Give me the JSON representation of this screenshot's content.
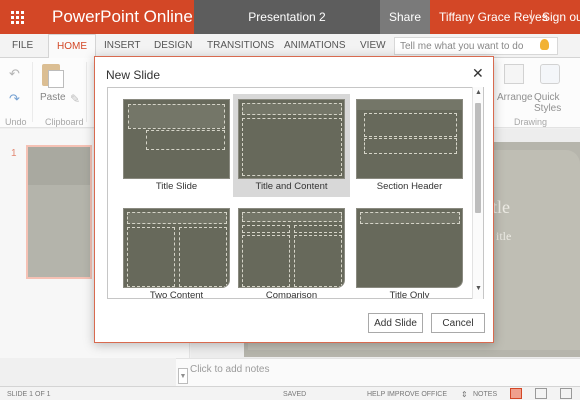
{
  "app": {
    "name": "PowerPoint Online",
    "doc_title": "Presentation 2",
    "share": "Share",
    "user": "Tiffany Grace Reyes",
    "sign_out": "Sign out"
  },
  "ribbon": {
    "tabs": [
      "FILE",
      "HOME",
      "INSERT",
      "DESIGN",
      "TRANSITIONS",
      "ANIMATIONS",
      "VIEW"
    ],
    "active_tab": "HOME",
    "tell_me_placeholder": "Tell me what you want to do",
    "paste": "Paste",
    "arrange": "Arrange",
    "quick_styles": "Quick Styles",
    "groups": [
      "Undo",
      "Clipboard",
      "Drawing"
    ]
  },
  "thumbnails": {
    "slide_number": "1"
  },
  "slide": {
    "title_fragment": "tle",
    "subtitle_fragment": "itle"
  },
  "notes": {
    "placeholder": "Click to add notes"
  },
  "status": {
    "slide_count": "SLIDE 1 OF 1",
    "saved": "SAVED",
    "help": "HELP IMPROVE OFFICE",
    "notes": "NOTES"
  },
  "dialog": {
    "title": "New Slide",
    "layouts": [
      {
        "name": "Title Slide",
        "selected": false
      },
      {
        "name": "Title and Content",
        "selected": true
      },
      {
        "name": "Section Header",
        "selected": false
      },
      {
        "name": "Two Content",
        "selected": false
      },
      {
        "name": "Comparison",
        "selected": false
      },
      {
        "name": "Title Only",
        "selected": false
      }
    ],
    "add_button": "Add Slide",
    "cancel_button": "Cancel"
  },
  "colors": {
    "brand": "#d34726",
    "layout_background": "#67695b",
    "selected_layout": "#d8d8d8"
  }
}
